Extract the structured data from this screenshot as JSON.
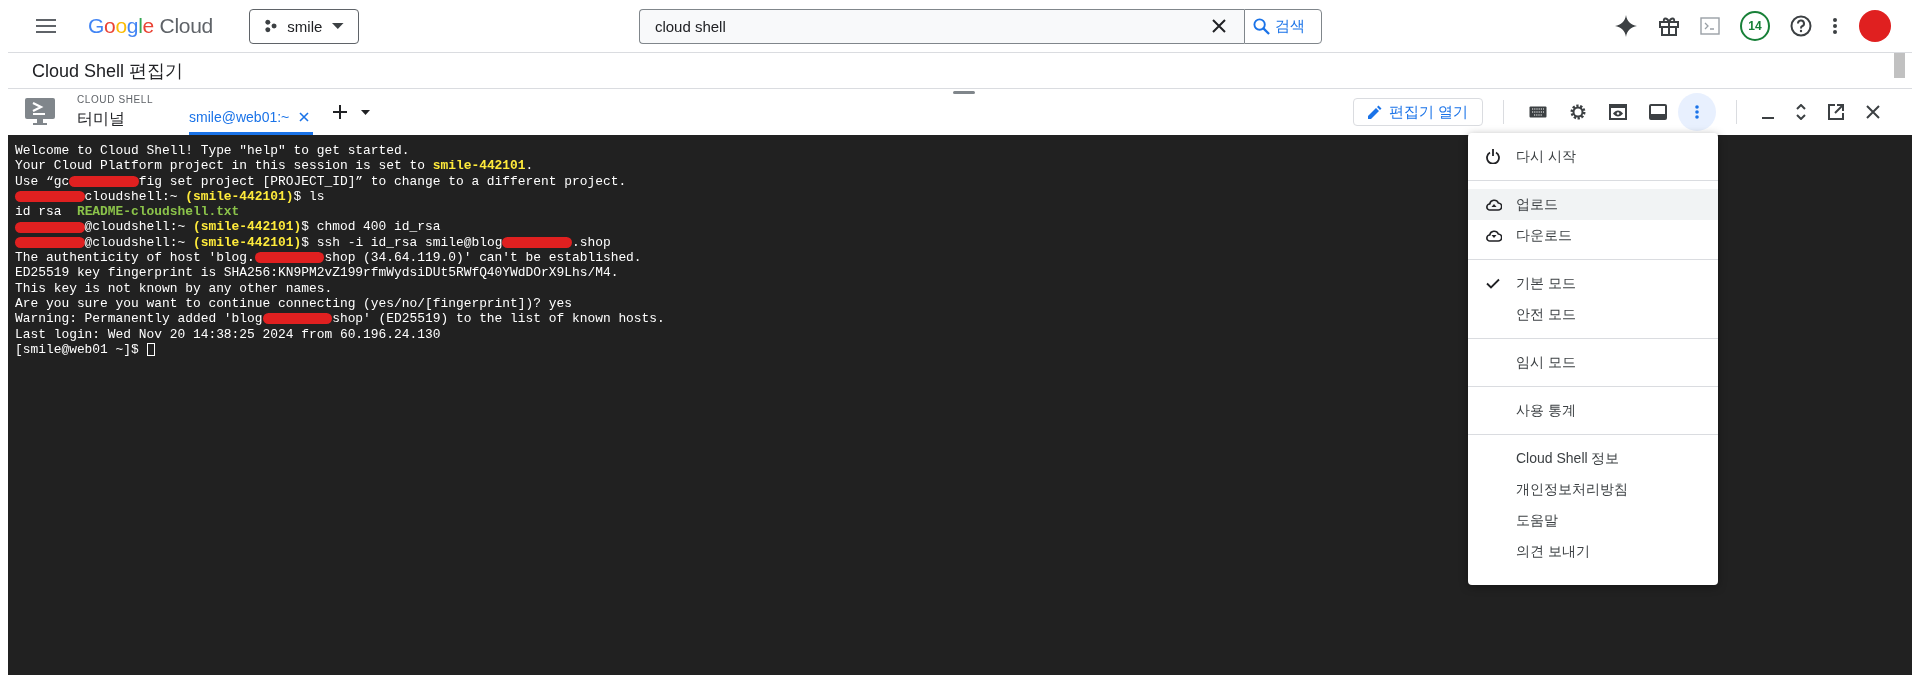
{
  "top_bar": {
    "logo": {
      "brand": "Google",
      "product": "Cloud"
    },
    "project": "smile",
    "search": {
      "value": "cloud shell",
      "button": "검색"
    },
    "notifications": "14"
  },
  "page_title": "Cloud Shell 편집기",
  "shell_header": {
    "overline": "CLOUD SHELL",
    "title": "터미널",
    "tabs": [
      {
        "label": "smile@web01:~",
        "selected": true
      }
    ],
    "open_editor": "편집기 열기",
    "menu_open": true
  },
  "terminal": {
    "lines": [
      [
        {
          "kind": "plain",
          "text": "Welcome to Cloud Shell! Type \"help\" to get started."
        }
      ],
      [
        {
          "kind": "plain",
          "text": "Your Cloud Platform project in this session is set to "
        },
        {
          "kind": "yellow",
          "text": "smile-442101"
        },
        {
          "kind": "plain",
          "text": "."
        }
      ],
      [
        {
          "kind": "plain",
          "text": "Use “gc"
        },
        {
          "kind": "redacted"
        },
        {
          "kind": "plain",
          "text": "fig set project [PROJECT_ID]” to change to a different project."
        }
      ],
      [
        {
          "kind": "redacted"
        },
        {
          "kind": "plain",
          "text": "cloudshell:~ "
        },
        {
          "kind": "yellow",
          "text": "(smile-442101)"
        },
        {
          "kind": "plain",
          "text": "$ ls"
        }
      ],
      [
        {
          "kind": "plain",
          "text": "id rsa  "
        },
        {
          "kind": "green",
          "text": "README-cloudshell.txt"
        }
      ],
      [
        {
          "kind": "redacted"
        },
        {
          "kind": "plain",
          "text": "@cloudshell:~ "
        },
        {
          "kind": "yellow",
          "text": "(smile-442101)"
        },
        {
          "kind": "plain",
          "text": "$ chmod 400 id_rsa"
        }
      ],
      [
        {
          "kind": "redacted"
        },
        {
          "kind": "plain",
          "text": "@cloudshell:~ "
        },
        {
          "kind": "yellow",
          "text": "(smile-442101)"
        },
        {
          "kind": "plain",
          "text": "$ ssh -i id_rsa smile@blog"
        },
        {
          "kind": "redacted"
        },
        {
          "kind": "plain",
          "text": ".shop"
        }
      ],
      [
        {
          "kind": "plain",
          "text": "The authenticity of host 'blog."
        },
        {
          "kind": "redacted"
        },
        {
          "kind": "plain",
          "text": "shop (34.64.119.0)' can't be established."
        }
      ],
      [
        {
          "kind": "plain",
          "text": "ED25519 key fingerprint is SHA256:KN9PM2vZ199rfmWydsiDUt5RWfQ40YWdDOrX9Lhs/M4."
        }
      ],
      [
        {
          "kind": "plain",
          "text": "This key is not known by any other names."
        }
      ],
      [
        {
          "kind": "plain",
          "text": "Are you sure you want to continue connecting (yes/no/[fingerprint])? yes"
        }
      ],
      [
        {
          "kind": "plain",
          "text": "Warning: Permanently added 'blog"
        },
        {
          "kind": "redacted"
        },
        {
          "kind": "plain",
          "text": "shop' (ED25519) to the list of known hosts."
        }
      ],
      [
        {
          "kind": "plain",
          "text": "Last login: Wed Nov 20 14:38:25 2024 from 60.196.24.130"
        }
      ],
      [
        {
          "kind": "plain",
          "text": "[smile@web01 ~]$ "
        },
        {
          "kind": "cursor"
        }
      ]
    ]
  },
  "menu": {
    "sections": [
      {
        "items": [
          {
            "kind": "power",
            "label": "다시 시작",
            "selected": false
          }
        ]
      },
      {
        "items": [
          {
            "kind": "upload",
            "label": "업로드",
            "selected": true
          },
          {
            "kind": "download",
            "label": "다운로드",
            "selected": false
          }
        ]
      },
      {
        "items": [
          {
            "kind": "mode",
            "label": "기본 모드",
            "checked": true,
            "selected": false
          },
          {
            "kind": "mode",
            "label": "안전 모드",
            "checked": false,
            "selected": false
          }
        ]
      },
      {
        "items": [
          {
            "kind": "plain",
            "label": "임시 모드",
            "selected": false
          }
        ]
      },
      {
        "items": [
          {
            "kind": "plain",
            "label": "사용 통계",
            "selected": false
          }
        ]
      },
      {
        "items": [
          {
            "kind": "plain",
            "label": "Cloud Shell 정보",
            "selected": false
          },
          {
            "kind": "plain",
            "label": "개인정보처리방침",
            "selected": false
          },
          {
            "kind": "plain",
            "label": "도움말",
            "selected": false
          },
          {
            "kind": "plain",
            "label": "의견 보내기",
            "selected": false
          }
        ]
      }
    ]
  }
}
